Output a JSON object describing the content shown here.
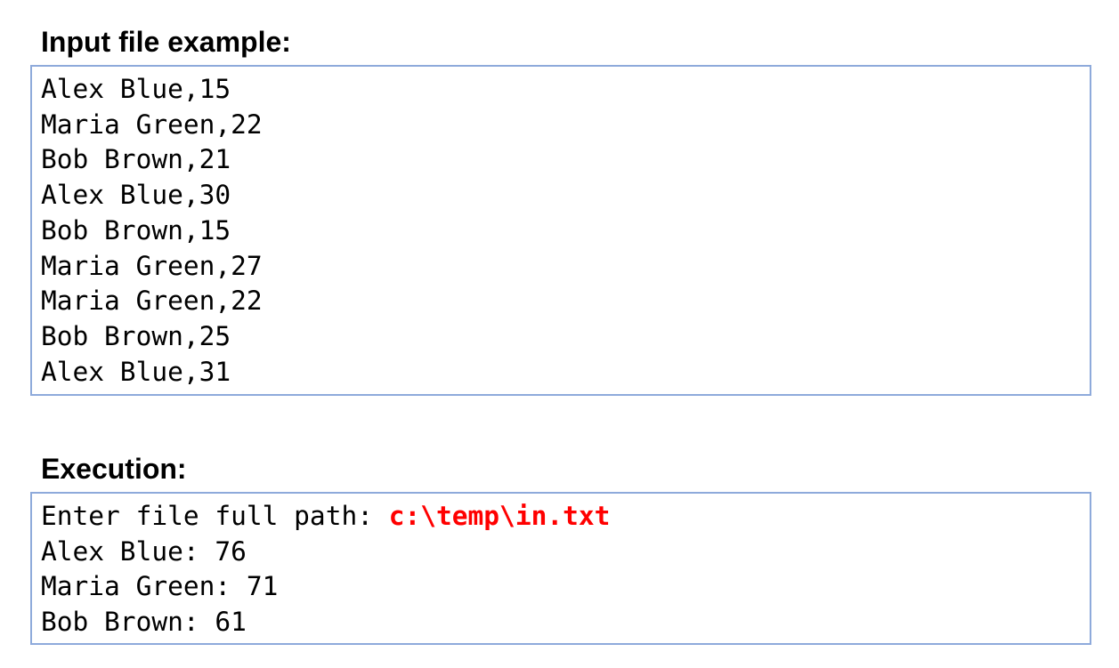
{
  "input_section": {
    "heading": "Input file example:",
    "lines": [
      "Alex Blue,15",
      "Maria Green,22",
      "Bob Brown,21",
      "Alex Blue,30",
      "Bob Brown,15",
      "Maria Green,27",
      "Maria Green,22",
      "Bob Brown,25",
      "Alex Blue,31"
    ]
  },
  "execution_section": {
    "heading": "Execution:",
    "prompt": "Enter file full path: ",
    "user_input": "c:\\temp\\in.txt",
    "output_lines": [
      "Alex Blue: 76",
      "Maria Green: 71",
      "Bob Brown: 61"
    ]
  },
  "colors": {
    "box_border": "#8eaadb",
    "user_input": "#ff0000"
  }
}
